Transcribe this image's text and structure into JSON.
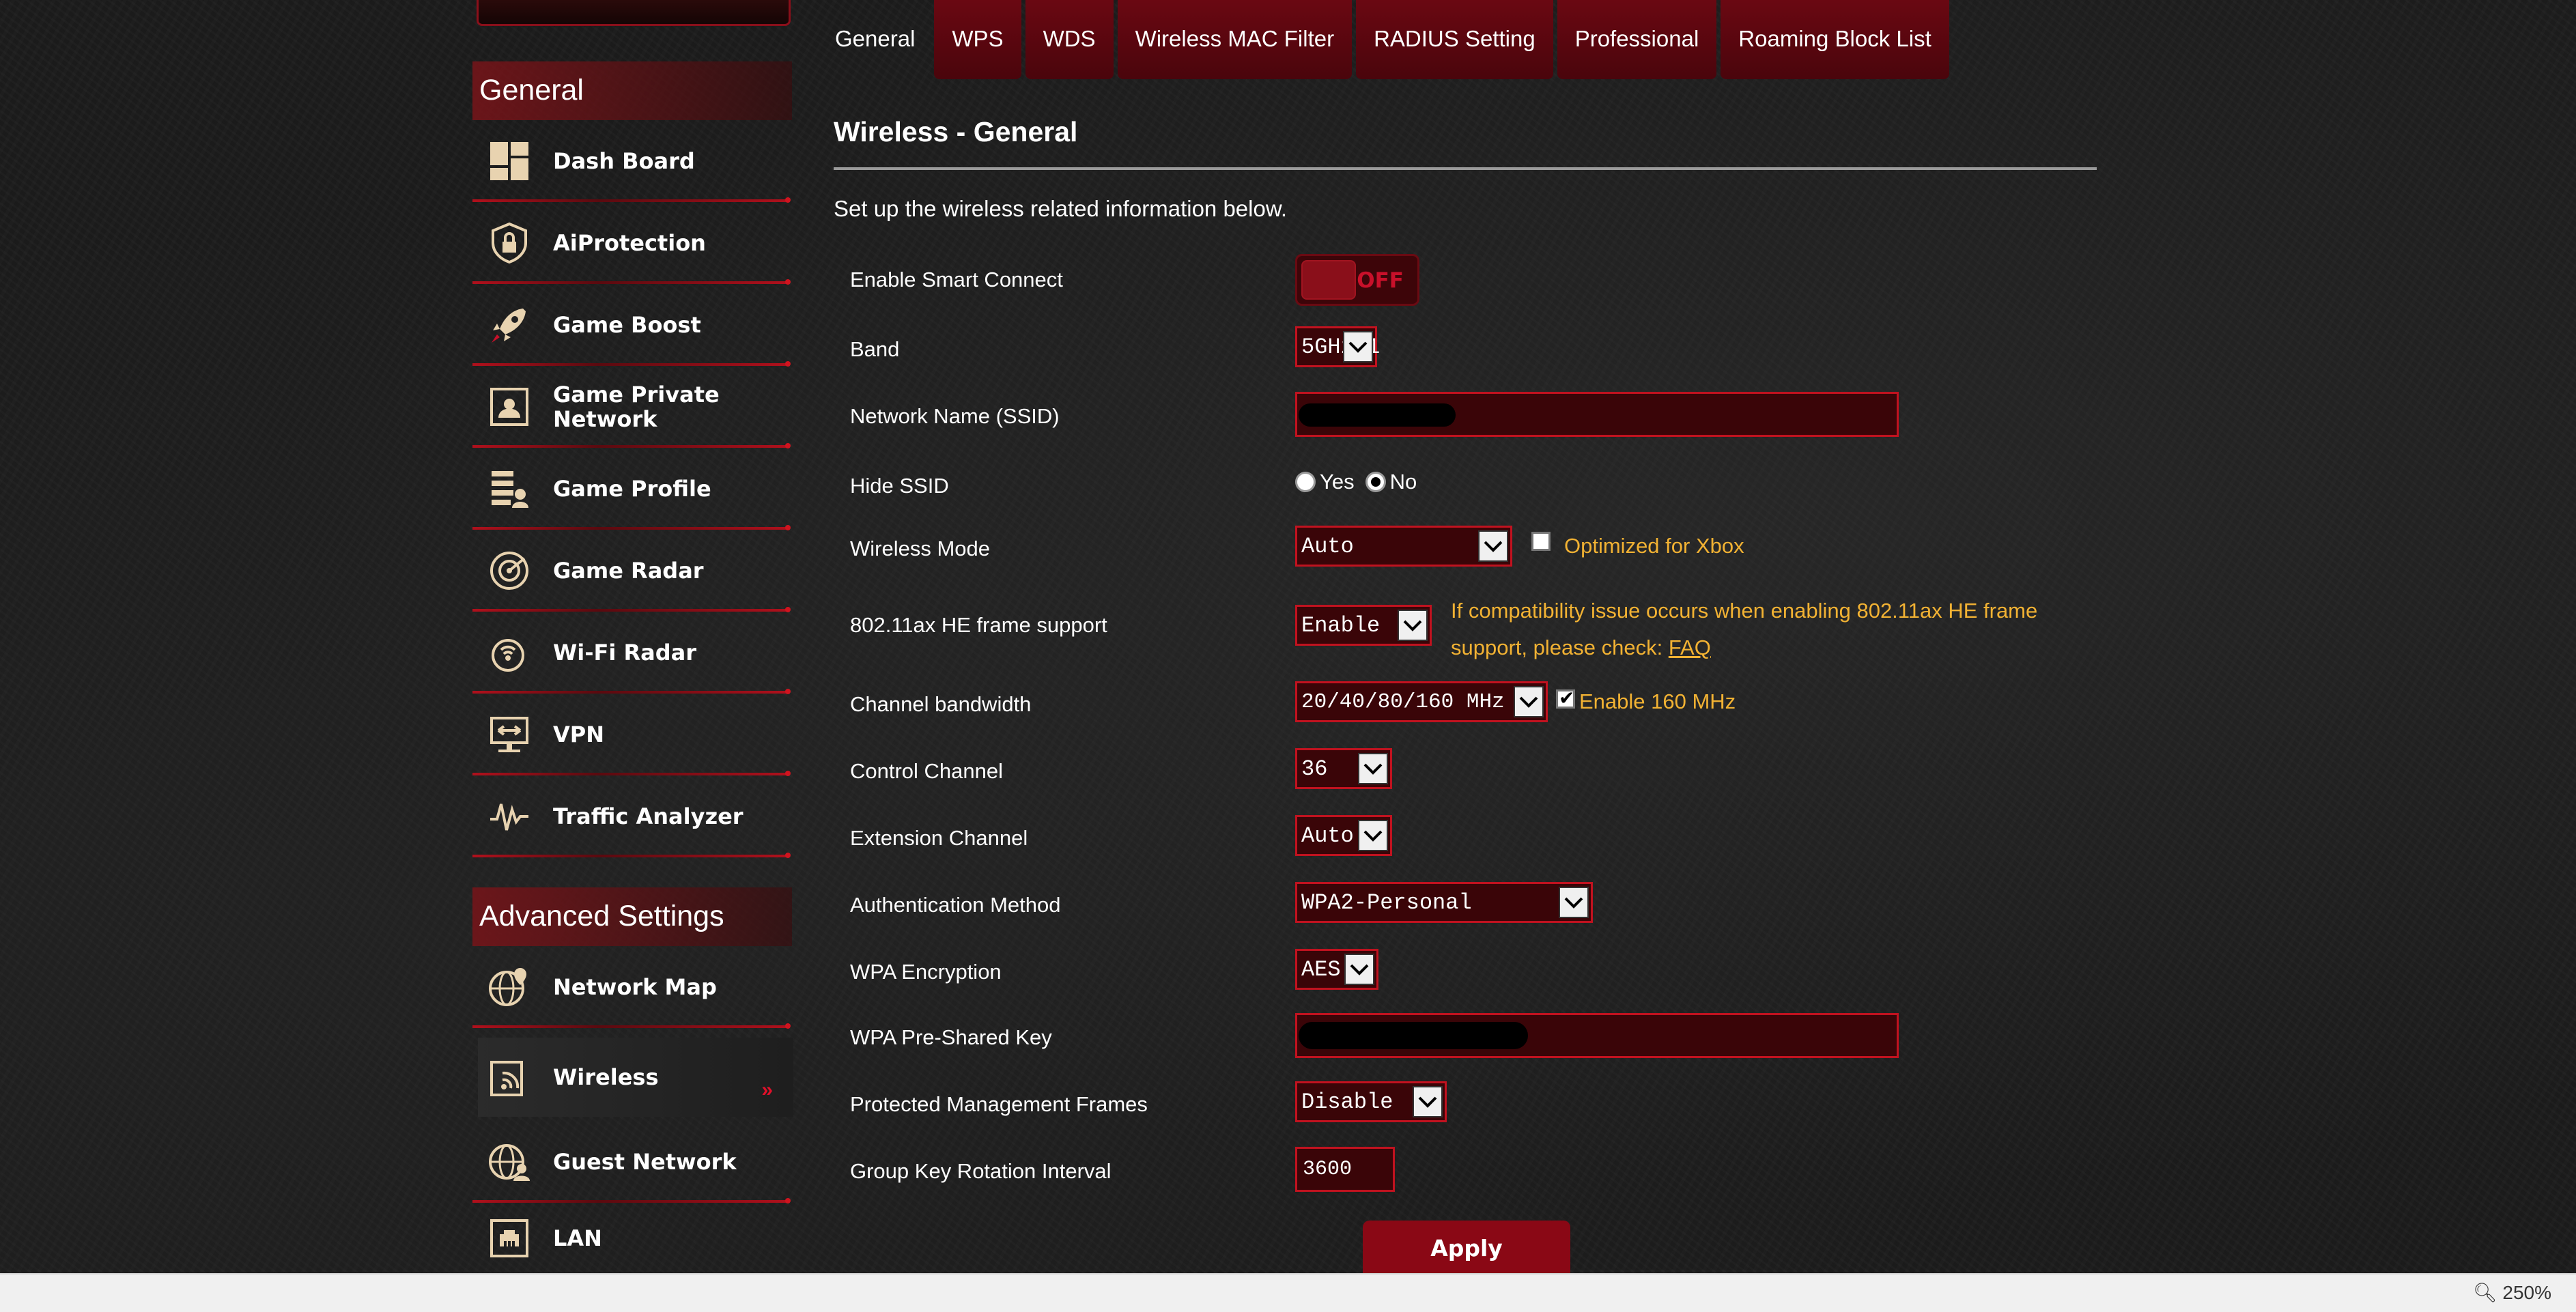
{
  "tabs": [
    {
      "label": "General",
      "active": true
    },
    {
      "label": "WPS"
    },
    {
      "label": "WDS"
    },
    {
      "label": "Wireless MAC Filter"
    },
    {
      "label": "RADIUS Setting"
    },
    {
      "label": "Professional"
    },
    {
      "label": "Roaming Block List"
    }
  ],
  "sidebar": {
    "general_header": "General",
    "general_items": [
      {
        "label": "Dash Board",
        "icon": "dashboard-icon"
      },
      {
        "label": "AiProtection",
        "icon": "shield-lock-icon"
      },
      {
        "label": "Game Boost",
        "icon": "rocket-icon"
      },
      {
        "label": "Game Private Network",
        "icon": "private-network-icon"
      },
      {
        "label": "Game Profile",
        "icon": "game-profile-icon"
      },
      {
        "label": "Game Radar",
        "icon": "radar-icon"
      },
      {
        "label": "Wi-Fi Radar",
        "icon": "wifi-radar-icon"
      },
      {
        "label": "VPN",
        "icon": "vpn-icon"
      },
      {
        "label": "Traffic Analyzer",
        "icon": "traffic-icon"
      }
    ],
    "advanced_header": "Advanced Settings",
    "advanced_items": [
      {
        "label": "Network Map",
        "icon": "globe-pin-icon"
      },
      {
        "label": "Wireless",
        "icon": "wireless-icon",
        "active": true
      },
      {
        "label": "Guest Network",
        "icon": "guest-globe-icon"
      },
      {
        "label": "LAN",
        "icon": "lan-port-icon"
      }
    ],
    "active_arrow": "»"
  },
  "page": {
    "title": "Wireless - General",
    "description": "Set up the wireless related information below."
  },
  "form": {
    "smart_connect": {
      "label": "Enable Smart Connect",
      "state": "OFF"
    },
    "band": {
      "label": "Band",
      "value": "5GHz-1"
    },
    "ssid": {
      "label": "Network Name (SSID)",
      "value": ""
    },
    "hide_ssid": {
      "label": "Hide SSID",
      "yes": "Yes",
      "no": "No",
      "selected": "No"
    },
    "wireless_mode": {
      "label": "Wireless Mode",
      "value": "Auto",
      "xbox_label": "Optimized for Xbox",
      "xbox_checked": false
    },
    "he_frame": {
      "label": "802.11ax HE frame support",
      "value": "Enable",
      "hint": "If compatibility issue occurs when enabling 802.11ax HE frame support, please check:",
      "faq": "FAQ"
    },
    "bandwidth": {
      "label": "Channel bandwidth",
      "value": "20/40/80/160 MHz",
      "enable160_label": "Enable 160 MHz",
      "enable160_checked": true
    },
    "control_channel": {
      "label": "Control Channel",
      "value": "36"
    },
    "extension_channel": {
      "label": "Extension Channel",
      "value": "Auto"
    },
    "auth_method": {
      "label": "Authentication Method",
      "value": "WPA2-Personal"
    },
    "wpa_encryption": {
      "label": "WPA Encryption",
      "value": "AES"
    },
    "psk": {
      "label": "WPA Pre-Shared Key",
      "value": ""
    },
    "pmf": {
      "label": "Protected Management Frames",
      "value": "Disable"
    },
    "group_key": {
      "label": "Group Key Rotation Interval",
      "value": "3600"
    }
  },
  "apply_label": "Apply",
  "statusbar": {
    "zoom": "250%"
  },
  "colors": {
    "accent": "#8a0815",
    "border": "#c1121f",
    "hint": "#f2b233",
    "background": "#1c1c1c"
  }
}
